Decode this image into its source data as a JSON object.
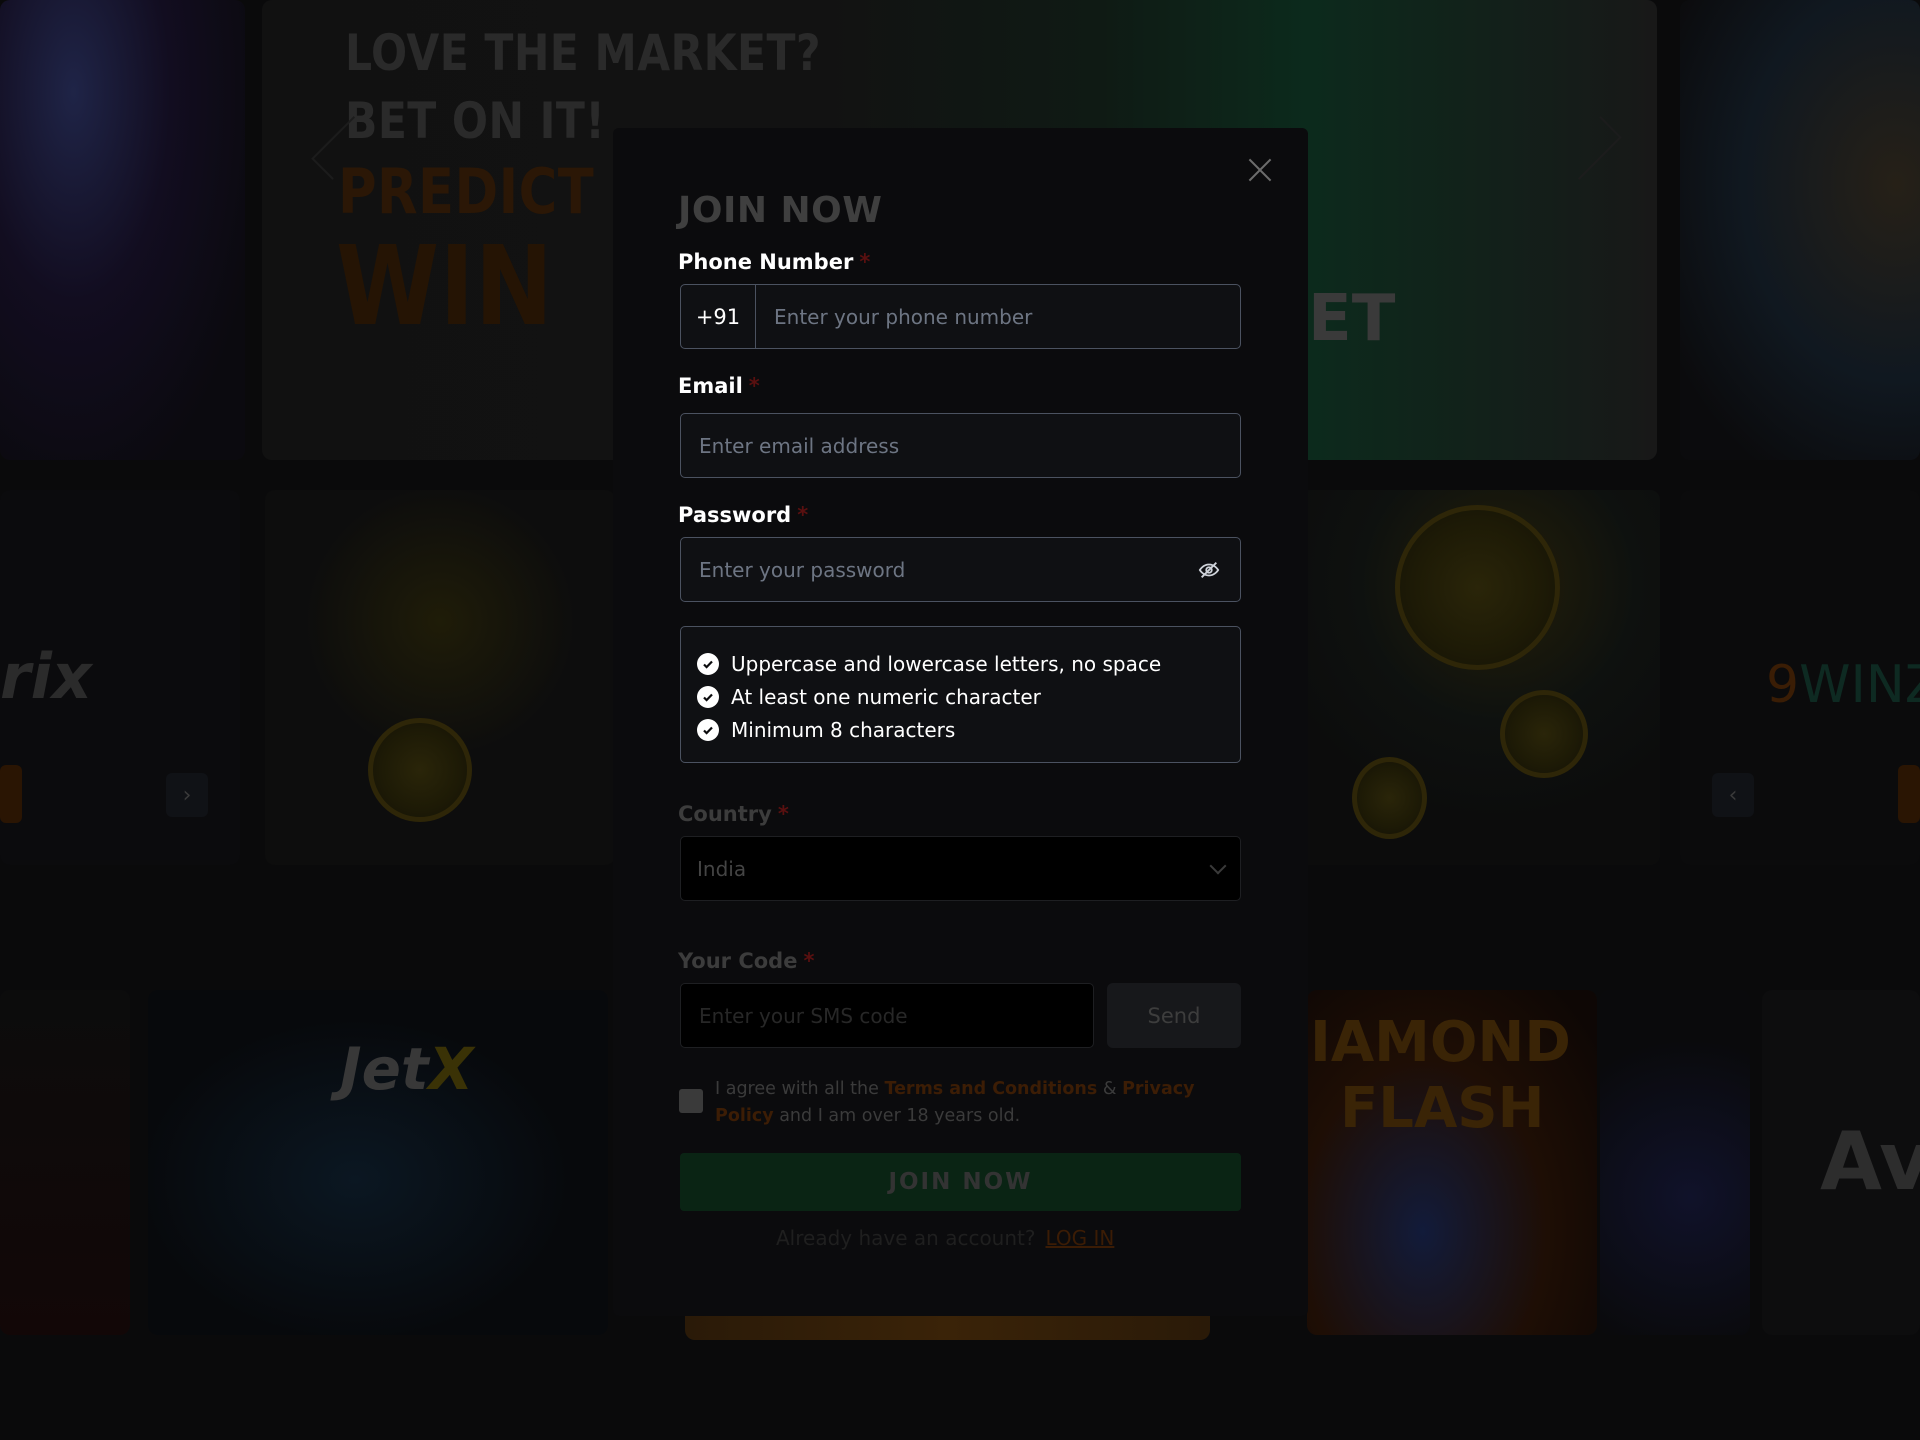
{
  "background": {
    "banner": {
      "line1": "LOVE THE MARKET?",
      "line2": "BET ON IT!",
      "line3": "PREDICT",
      "line4": "WIN",
      "partial_text": "ET"
    },
    "tiles": {
      "aviatrix_partial": "rix",
      "winz_prefix": "9",
      "winz_text": "WINZ",
      "jetx_prefix": "Jet",
      "jetx_suffix": "X",
      "diamond_title_line1": "IAMOND",
      "diamond_title_line2": "FLASH",
      "right_partial": "Av"
    },
    "carousel": {
      "next_icon": "›",
      "prev_icon": "‹"
    }
  },
  "modal": {
    "title": "JOIN NOW",
    "close_icon": "close-icon",
    "required_mark": "*",
    "phone": {
      "label": "Phone Number",
      "prefix": "+91",
      "placeholder": "Enter your phone number",
      "value": ""
    },
    "email": {
      "label": "Email",
      "placeholder": "Enter email address",
      "value": ""
    },
    "password": {
      "label": "Password",
      "placeholder": "Enter your password",
      "value": "",
      "toggle_icon": "eye-slash-icon"
    },
    "password_rules": [
      "Uppercase and lowercase letters, no space",
      "At least one numeric character",
      "Minimum 8 characters"
    ],
    "country": {
      "label": "Country",
      "selected": "India"
    },
    "code": {
      "label": "Your Code",
      "placeholder": "Enter your SMS code",
      "value": "",
      "send_label": "Send"
    },
    "agreement": {
      "checked": false,
      "prefix": "I agree with all the ",
      "terms_link": "Terms and Conditions",
      "amp": " & ",
      "privacy_link": "Privacy Policy",
      "suffix": " and I am over 18 years old."
    },
    "submit_label": "JOIN NOW",
    "login_prompt": "Already have an account?",
    "login_link": "LOG IN"
  },
  "colors": {
    "accent_orange": "#e67817",
    "submit_green": "#1e8a43",
    "required_red": "#d32020"
  }
}
